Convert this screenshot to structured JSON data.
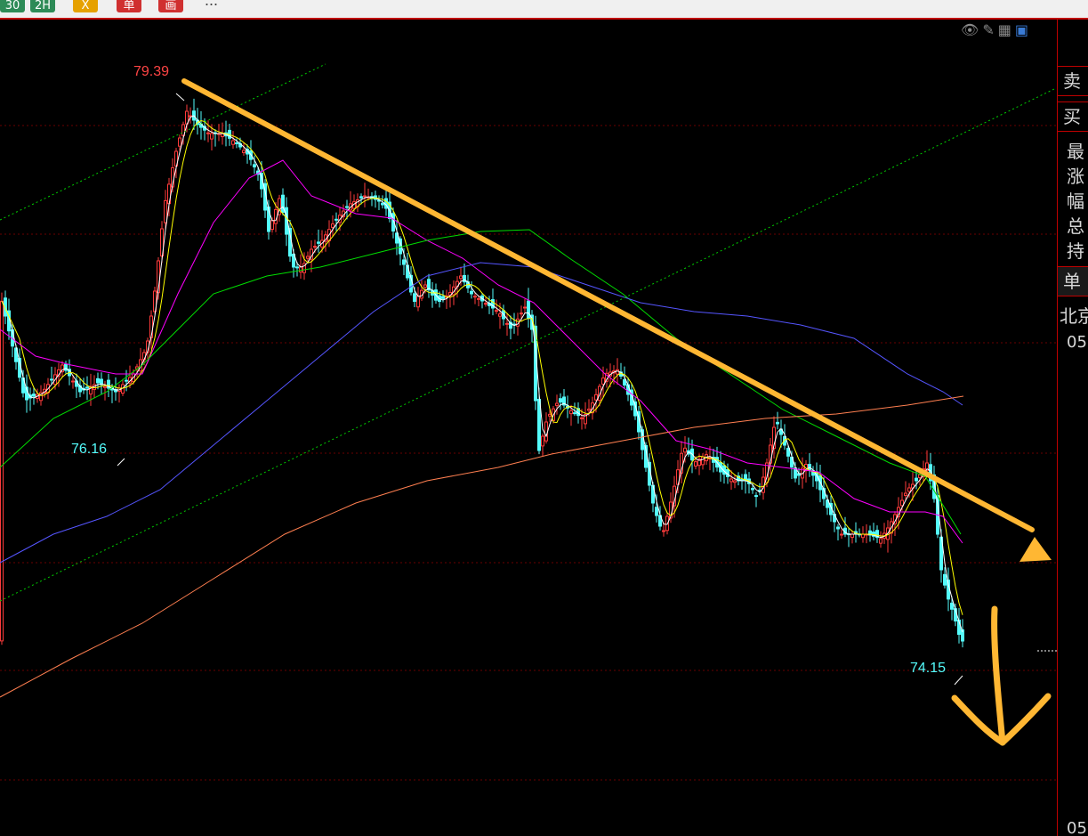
{
  "toolbar": {
    "buttons": [
      {
        "label": "30",
        "color": "#2e8b57"
      },
      {
        "label": "2H",
        "color": "#2e8b57"
      },
      {
        "label": "X",
        "color": "#e6a100"
      },
      {
        "label": "单",
        "color": "#d03030"
      },
      {
        "label": "画",
        "color": "#d03030"
      }
    ],
    "more": "..."
  },
  "top_icons": [
    "eye-icon",
    "pencil-icon",
    "grid-icon",
    "panel-icon"
  ],
  "right_panel": {
    "sell": "卖",
    "buy": "买",
    "rows": [
      "最",
      "涨",
      "幅",
      "总",
      "持"
    ],
    "unit": "单",
    "beijing": "北京",
    "top_price": "05",
    "bottom_price": "05"
  },
  "colors": {
    "up": "#ff3b3b",
    "down": "#54fcfc",
    "ma5": "#ffffff",
    "ma10": "#ffff00",
    "ma20": "#ff00ff",
    "ma40": "#00dd00",
    "ma60": "#5555ff",
    "ma120": "#ff7f50",
    "trend": "#ffb733",
    "channel": "#00cc00",
    "grid": "#6a0000"
  },
  "chart_data": {
    "type": "candlestick",
    "ylim": [
      72.6,
      80.2
    ],
    "annotations": {
      "high": {
        "label": "79.39",
        "value": 79.39,
        "index": 50
      },
      "low_left": {
        "label": "76.16",
        "value": 76.16,
        "index": 33
      },
      "low_right": {
        "label": "74.15",
        "value": 74.15,
        "index": 269
      }
    },
    "trend_line": {
      "from": [
        50,
        79.39
      ],
      "to_label": "arrow down-right"
    },
    "arrow_down": "hand-drawn downward arrow"
  }
}
